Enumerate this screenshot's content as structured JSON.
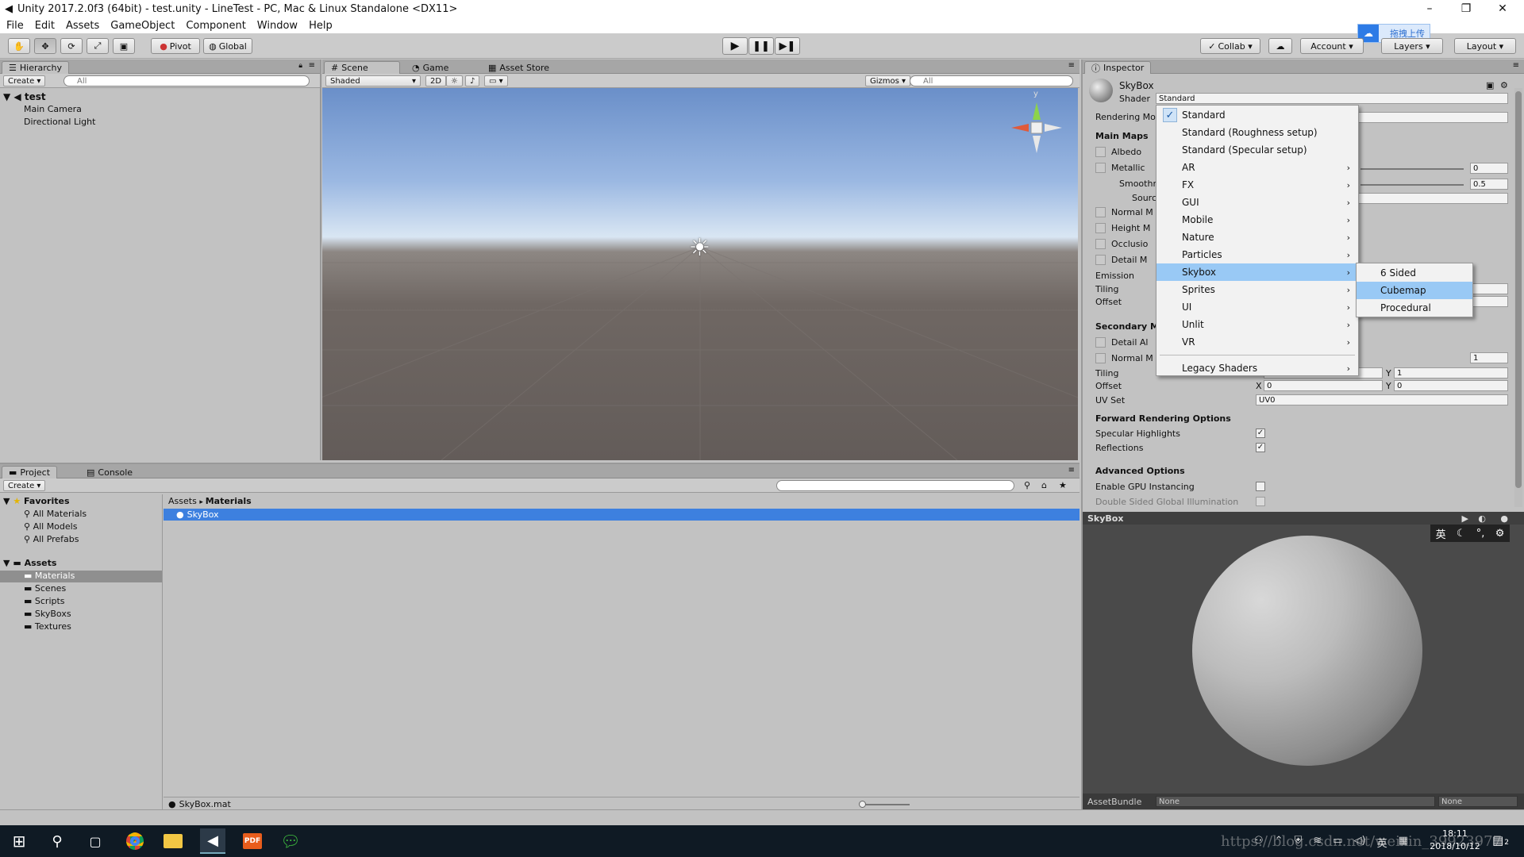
{
  "window": {
    "title": "Unity 2017.2.0f3 (64bit) - test.unity - LineTest - PC, Mac & Linux Standalone <DX11>",
    "minimize": "–",
    "restore": "❐",
    "close": "✕"
  },
  "menubar": [
    "File",
    "Edit",
    "Assets",
    "GameObject",
    "Component",
    "Window",
    "Help"
  ],
  "toolbar": {
    "pivot": "Pivot",
    "global": "Global",
    "upload_label": "拖拽上传",
    "collab": "Collab ▾",
    "account": "Account ▾",
    "layers": "Layers ▾",
    "layout": "Layout ▾"
  },
  "hierarchy": {
    "tab": "Hierarchy",
    "create": "Create ▾",
    "search_placeholder": "All",
    "scene": "test",
    "items": [
      "Main Camera",
      "Directional Light"
    ]
  },
  "scene_view": {
    "tabs": [
      "Scene",
      "Game",
      "Asset Store"
    ],
    "shading": "Shaded",
    "mode_2d": "2D",
    "gizmos": "Gizmos ▾",
    "search_placeholder": "All",
    "gizmo_axis_y": "y"
  },
  "project": {
    "tabs": [
      "Project",
      "Console"
    ],
    "create": "Create ▾",
    "favorites_label": "Favorites",
    "favorites": [
      "All Materials",
      "All Models",
      "All Prefabs"
    ],
    "assets_label": "Assets",
    "folders": [
      "Materials",
      "Scenes",
      "Scripts",
      "SkyBoxs",
      "Textures"
    ],
    "selected_folder": "Materials",
    "breadcrumb": [
      "Assets",
      "Materials"
    ],
    "files": [
      "SkyBox"
    ],
    "footer_file": "SkyBox.mat"
  },
  "inspector": {
    "tab": "Inspector",
    "material_name": "SkyBox",
    "shader_label": "Shader",
    "shader_value": "Standard",
    "rendering_mode": "Rendering Mo",
    "main_maps": "Main Maps",
    "albedo": "Albedo",
    "metallic": "Metallic",
    "metallic_value": "0",
    "smoothness": "Smoothn",
    "smoothness_value": "0.5",
    "source": "Sourc",
    "normal_map": "Normal M",
    "height_map": "Height M",
    "occlusion": "Occlusio",
    "detail_mask": "Detail M",
    "emission": "Emission",
    "tiling": "Tiling",
    "offset": "Offset",
    "secondary_maps": "Secondary M",
    "detail_albedo": "Detail Al",
    "detail_normal": "Normal M",
    "detail_normal_value": "1",
    "sec_tiling": "Tiling",
    "sec_tiling_y": "1",
    "sec_offset": "Offset",
    "sec_offset_x": "0",
    "sec_offset_y": "0",
    "uv_set": "UV Set",
    "uv_set_value": "UV0",
    "forward_options": "Forward Rendering Options",
    "specular_highlights": "Specular Highlights",
    "reflections": "Reflections",
    "advanced_options": "Advanced Options",
    "gpu_instancing": "Enable GPU Instancing",
    "double_sided_gi": "Double Sided Global Illumination",
    "x_label": "X",
    "y_label": "Y",
    "check_mark": "✓"
  },
  "shader_menu": {
    "items": [
      {
        "label": "Standard",
        "checked": true,
        "submenu": false
      },
      {
        "label": "Standard (Roughness setup)",
        "checked": false,
        "submenu": false
      },
      {
        "label": "Standard (Specular setup)",
        "checked": false,
        "submenu": false
      },
      {
        "label": "AR",
        "checked": false,
        "submenu": true
      },
      {
        "label": "FX",
        "checked": false,
        "submenu": true
      },
      {
        "label": "GUI",
        "checked": false,
        "submenu": true
      },
      {
        "label": "Mobile",
        "checked": false,
        "submenu": true
      },
      {
        "label": "Nature",
        "checked": false,
        "submenu": true
      },
      {
        "label": "Particles",
        "checked": false,
        "submenu": true
      },
      {
        "label": "Skybox",
        "checked": false,
        "submenu": true
      },
      {
        "label": "Sprites",
        "checked": false,
        "submenu": true
      },
      {
        "label": "UI",
        "checked": false,
        "submenu": true
      },
      {
        "label": "Unlit",
        "checked": false,
        "submenu": true
      },
      {
        "label": "VR",
        "checked": false,
        "submenu": true
      },
      {
        "label": "Legacy Shaders",
        "checked": false,
        "submenu": true
      }
    ],
    "highlighted": "Skybox",
    "arrow": "›",
    "check": "✓"
  },
  "skybox_submenu": {
    "items": [
      "6 Sided",
      "Cubemap",
      "Procedural"
    ],
    "highlighted": "Cubemap"
  },
  "preview": {
    "title": "SkyBox",
    "ime": "英",
    "assetbundle_label": "AssetBundle",
    "assetbundle_value": "None",
    "variant_value": "None"
  },
  "taskbar": {
    "time": "18:11",
    "date": "2018/10/12",
    "ime": "英",
    "pdf_label": "PDF",
    "watermark": "https://blog.csdn.net/weixin_39923977",
    "notification_count": "2"
  },
  "colors": {
    "unity_panel": "#c2c2c2",
    "selection_blue": "#3d80df",
    "menu_highlight": "#99c9f5",
    "taskbar": "#0f1a24"
  }
}
